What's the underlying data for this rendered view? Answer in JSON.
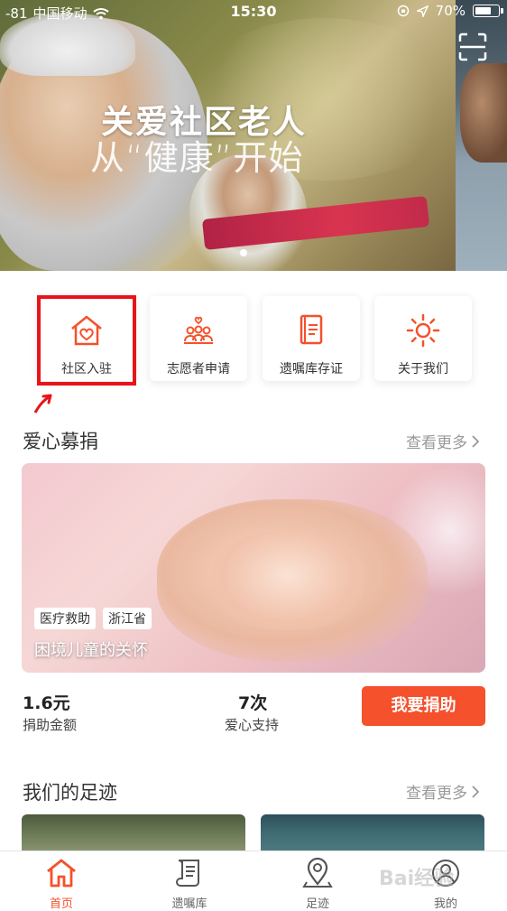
{
  "status_bar": {
    "signal": "-81",
    "carrier": "中国移动",
    "time": "15:30",
    "battery": "70%"
  },
  "hero": {
    "title": "关爱社区老人",
    "subtitle": "从“健康”开始"
  },
  "quick_menu": [
    {
      "label": "社区入驻",
      "icon": "house-heart-icon"
    },
    {
      "label": "志愿者申请",
      "icon": "volunteers-icon"
    },
    {
      "label": "遗嘱库存证",
      "icon": "document-icon"
    },
    {
      "label": "关于我们",
      "icon": "sun-icon"
    }
  ],
  "donation_section": {
    "title": "爱心募捐",
    "see_more": "查看更多",
    "tags": [
      "医疗救助",
      "浙江省"
    ],
    "caption": "困境儿童的关怀",
    "amount_value": "1.6元",
    "amount_label": "捐助金额",
    "support_value": "7次",
    "support_label": "爱心支持",
    "donate_button": "我要捐助"
  },
  "footprints_section": {
    "title": "我们的足迹",
    "see_more": "查看更多"
  },
  "tab_bar": [
    {
      "label": "首页",
      "icon": "home-icon",
      "active": true
    },
    {
      "label": "遗嘱库",
      "icon": "scroll-icon",
      "active": false
    },
    {
      "label": "足迹",
      "icon": "map-pin-icon",
      "active": false
    },
    {
      "label": "我的",
      "icon": "profile-icon",
      "active": false
    }
  ],
  "watermark": "Bai经验",
  "colors": {
    "accent": "#f4512c",
    "highlight": "#e8141a"
  }
}
